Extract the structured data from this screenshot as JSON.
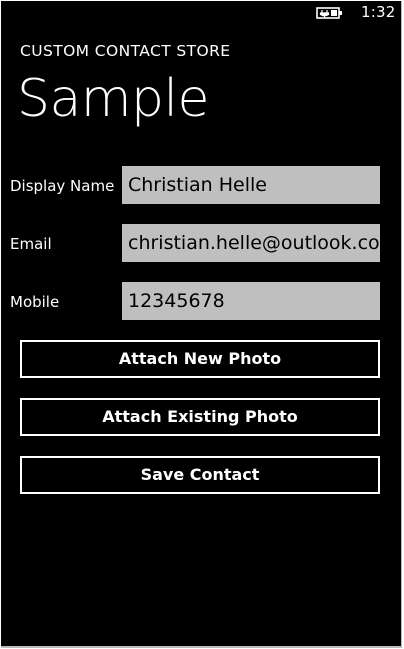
{
  "status_bar": {
    "battery_icon": "battery-charging-icon",
    "time": "1:32"
  },
  "header": {
    "app_title": "CUSTOM CONTACT STORE",
    "page_title": "Sample"
  },
  "form": {
    "display_name": {
      "label": "Display Name",
      "value": "Christian Helle"
    },
    "email": {
      "label": "Email",
      "value": "christian.helle@outlook.co"
    },
    "mobile": {
      "label": "Mobile",
      "value": "12345678"
    }
  },
  "buttons": {
    "attach_new_photo": "Attach New Photo",
    "attach_existing_photo": "Attach Existing Photo",
    "save_contact": "Save Contact"
  },
  "colors": {
    "background": "#000000",
    "foreground": "#ffffff",
    "textbox_background": "#bfbfbf"
  }
}
